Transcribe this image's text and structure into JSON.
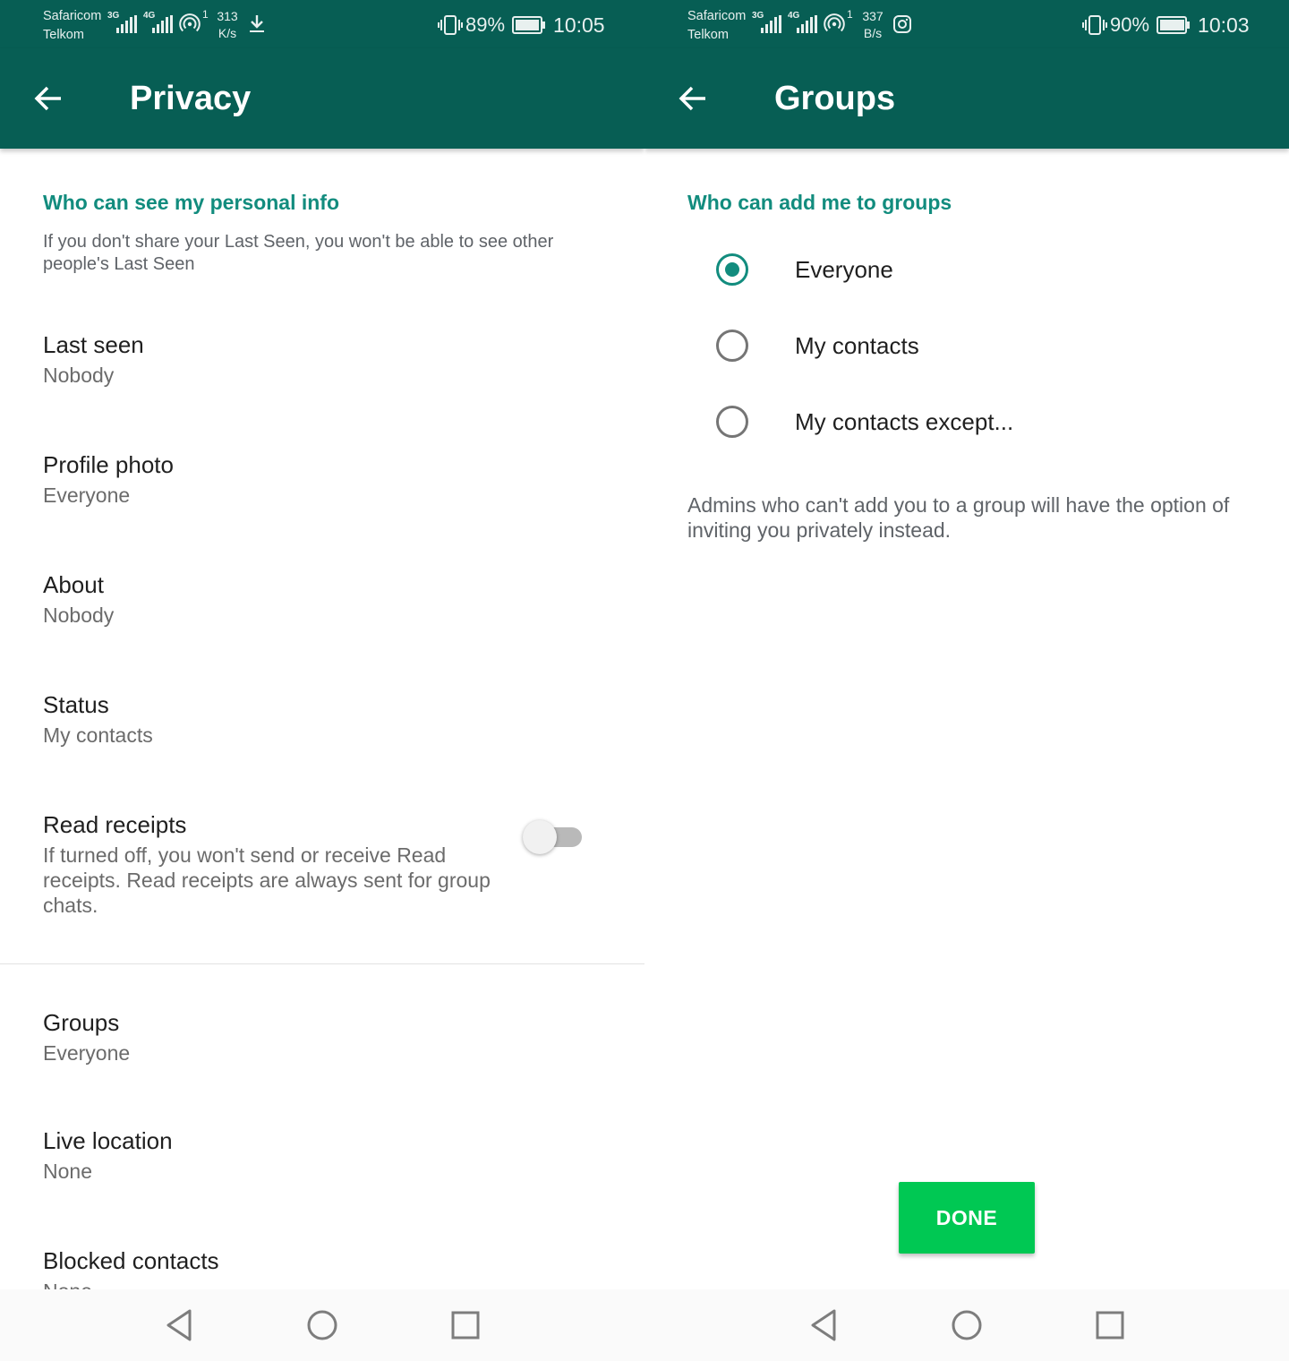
{
  "colors": {
    "toolbar": "#075e54",
    "accent": "#128c7e",
    "done_button": "#00c853",
    "text_primary": "#1f1f1f",
    "text_secondary": "#6b6b6b"
  },
  "icons": {
    "back": "arrow-left-icon",
    "vibrate": "vibrate-icon",
    "battery": "battery-icon",
    "hotspot": "hotspot-icon",
    "download": "download-icon",
    "instagram": "instagram-icon",
    "nav_back": "triangle-back-icon",
    "nav_home": "circle-home-icon",
    "nav_recents": "square-recents-icon"
  },
  "left_screen": {
    "status": {
      "carrier1": "Safaricom",
      "carrier2": "Telkom",
      "net1": "3G",
      "net2": "4G",
      "hotspot_count": "1",
      "speed_value": "313",
      "speed_unit": "K/s",
      "battery": "89%",
      "time": "10:05"
    },
    "title": "Privacy",
    "section_header": "Who can see my personal info",
    "section_desc": "If you don't share your Last Seen, you won't be able to see other people's Last Seen",
    "items": [
      {
        "title": "Last seen",
        "subtitle": "Nobody"
      },
      {
        "title": "Profile photo",
        "subtitle": "Everyone"
      },
      {
        "title": "About",
        "subtitle": "Nobody"
      },
      {
        "title": "Status",
        "subtitle": "My contacts"
      },
      {
        "title": "Read receipts",
        "subtitle": "If turned off, you won't send or receive Read receipts. Read receipts are always sent for group chats."
      },
      {
        "title": "Groups",
        "subtitle": "Everyone"
      },
      {
        "title": "Live location",
        "subtitle": "None"
      },
      {
        "title": "Blocked contacts",
        "subtitle": "None"
      }
    ],
    "read_receipts_enabled": false
  },
  "right_screen": {
    "status": {
      "carrier1": "Safaricom",
      "carrier2": "Telkom",
      "net1": "3G",
      "net2": "4G",
      "hotspot_count": "1",
      "speed_value": "337",
      "speed_unit": "B/s",
      "battery": "90%",
      "time": "10:03"
    },
    "title": "Groups",
    "section_header": "Who can add me to groups",
    "options": [
      {
        "label": "Everyone",
        "selected": true
      },
      {
        "label": "My contacts",
        "selected": false
      },
      {
        "label": "My contacts except...",
        "selected": false
      }
    ],
    "note": "Admins who can't add you to a group will have the option of inviting you privately instead.",
    "done_label": "DONE"
  }
}
